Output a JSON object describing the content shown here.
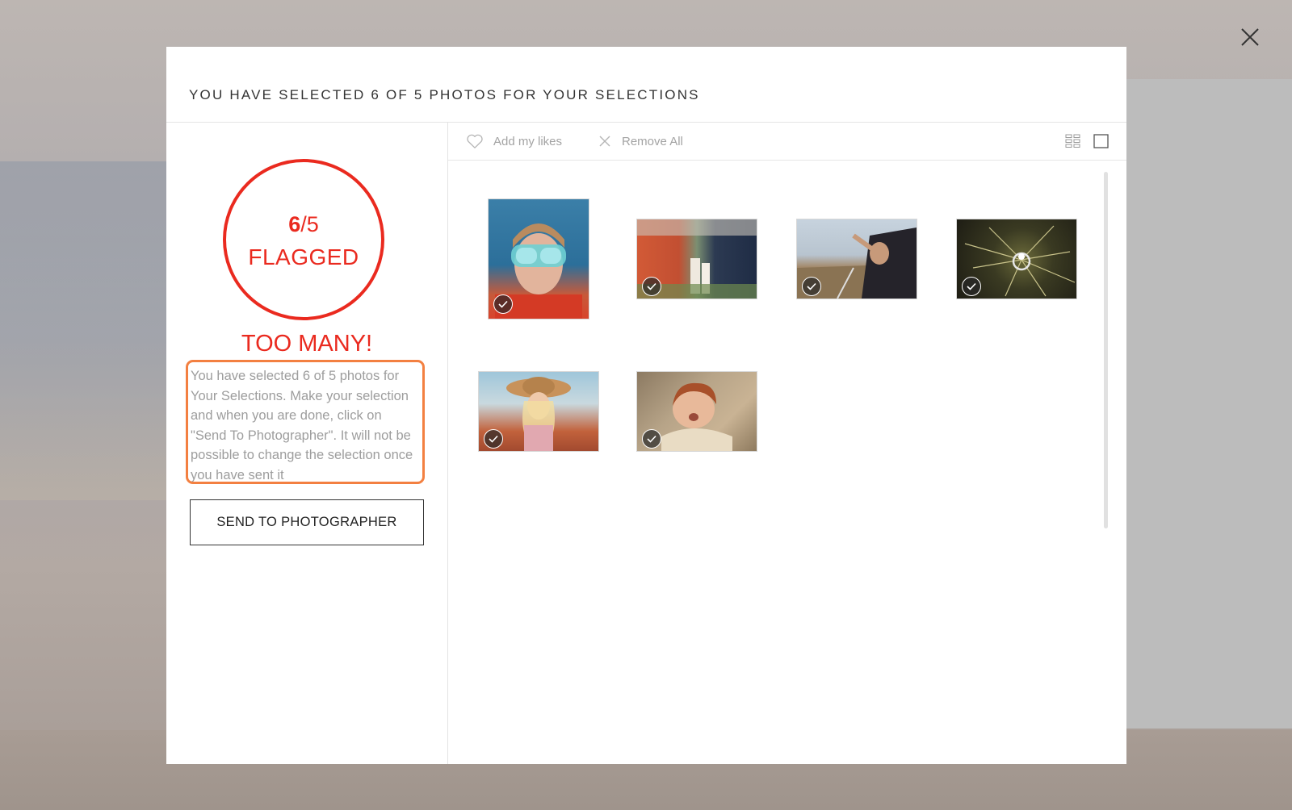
{
  "modal": {
    "title": "YOU HAVE SELECTED 6 OF 5 PHOTOS FOR YOUR SELECTIONS"
  },
  "counter": {
    "selected": "6",
    "limit_text": "/5",
    "label": "FLAGGED",
    "warning": "TOO MANY!"
  },
  "info_text": "You have selected 6 of 5 photos for Your Selections. Make your selection and when you are done, click on \"Send To Photographer\". It will not be possible to change the selection once you have sent it",
  "send_button": "SEND TO PHOTOGRAPHER",
  "toolbar": {
    "add_likes": "Add my likes",
    "remove_all": "Remove All"
  },
  "colors": {
    "accent": "#ea2a1f",
    "highlight": "#f38041"
  },
  "icons": [
    "close-icon",
    "heart-icon",
    "x-icon",
    "grid-view-icon",
    "single-view-icon",
    "check-icon"
  ]
}
